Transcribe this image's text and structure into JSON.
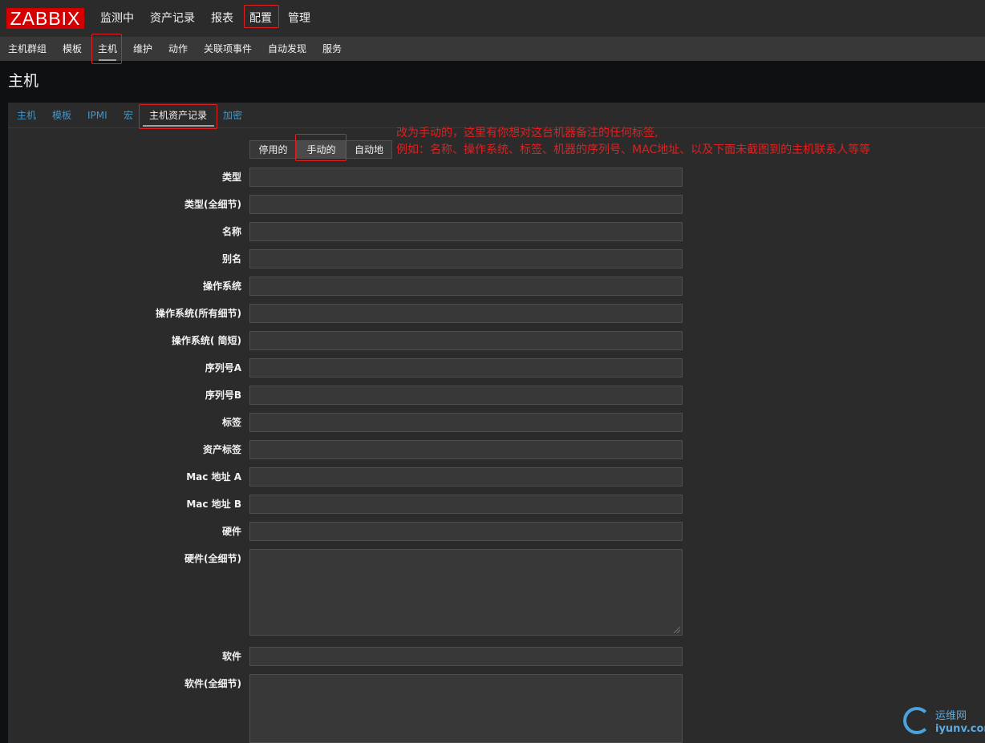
{
  "logo": {
    "text": "ZABBIX"
  },
  "top_menu": [
    {
      "label": "监测中"
    },
    {
      "label": "资产记录"
    },
    {
      "label": "报表"
    },
    {
      "label": "配置"
    },
    {
      "label": "管理"
    }
  ],
  "sub_menu": [
    {
      "label": "主机群组"
    },
    {
      "label": "模板"
    },
    {
      "label": "主机"
    },
    {
      "label": "维护"
    },
    {
      "label": "动作"
    },
    {
      "label": "关联项事件"
    },
    {
      "label": "自动发现"
    },
    {
      "label": "服务"
    }
  ],
  "page_title": "主机",
  "tabs": [
    {
      "label": "主机"
    },
    {
      "label": "模板"
    },
    {
      "label": "IPMI"
    },
    {
      "label": "宏"
    },
    {
      "label": "主机资产记录"
    },
    {
      "label": "加密"
    }
  ],
  "inventory_mode": {
    "options": [
      "停用的",
      "手动的",
      "自动地"
    ],
    "selected": "手动的"
  },
  "annotation": {
    "line1": "改为手动的，这里有你想对这台机器备注的任何标签,",
    "line2": "例如：名称、操作系统、标签、机器的序列号、MAC地址、以及下面未截图到的主机联系人等等"
  },
  "fields": [
    {
      "label": "类型"
    },
    {
      "label": "类型(全细节)"
    },
    {
      "label": "名称"
    },
    {
      "label": "别名"
    },
    {
      "label": "操作系统"
    },
    {
      "label": "操作系统(所有细节)"
    },
    {
      "label": "操作系统( 简短)"
    },
    {
      "label": "序列号A"
    },
    {
      "label": "序列号B"
    },
    {
      "label": "标签"
    },
    {
      "label": "资产标签"
    },
    {
      "label": "Mac 地址 A"
    },
    {
      "label": "Mac 地址 B"
    },
    {
      "label": "硬件"
    },
    {
      "label": "硬件(全细节)"
    },
    {
      "label": "软件"
    },
    {
      "label": "软件(全细节)"
    }
  ],
  "watermark": {
    "top": "运维网",
    "bottom": "iyunv.com"
  },
  "colors": {
    "brand": "#d40000",
    "link": "#4796c4",
    "annotation": "#e02020",
    "background": "#2b2b2b"
  }
}
